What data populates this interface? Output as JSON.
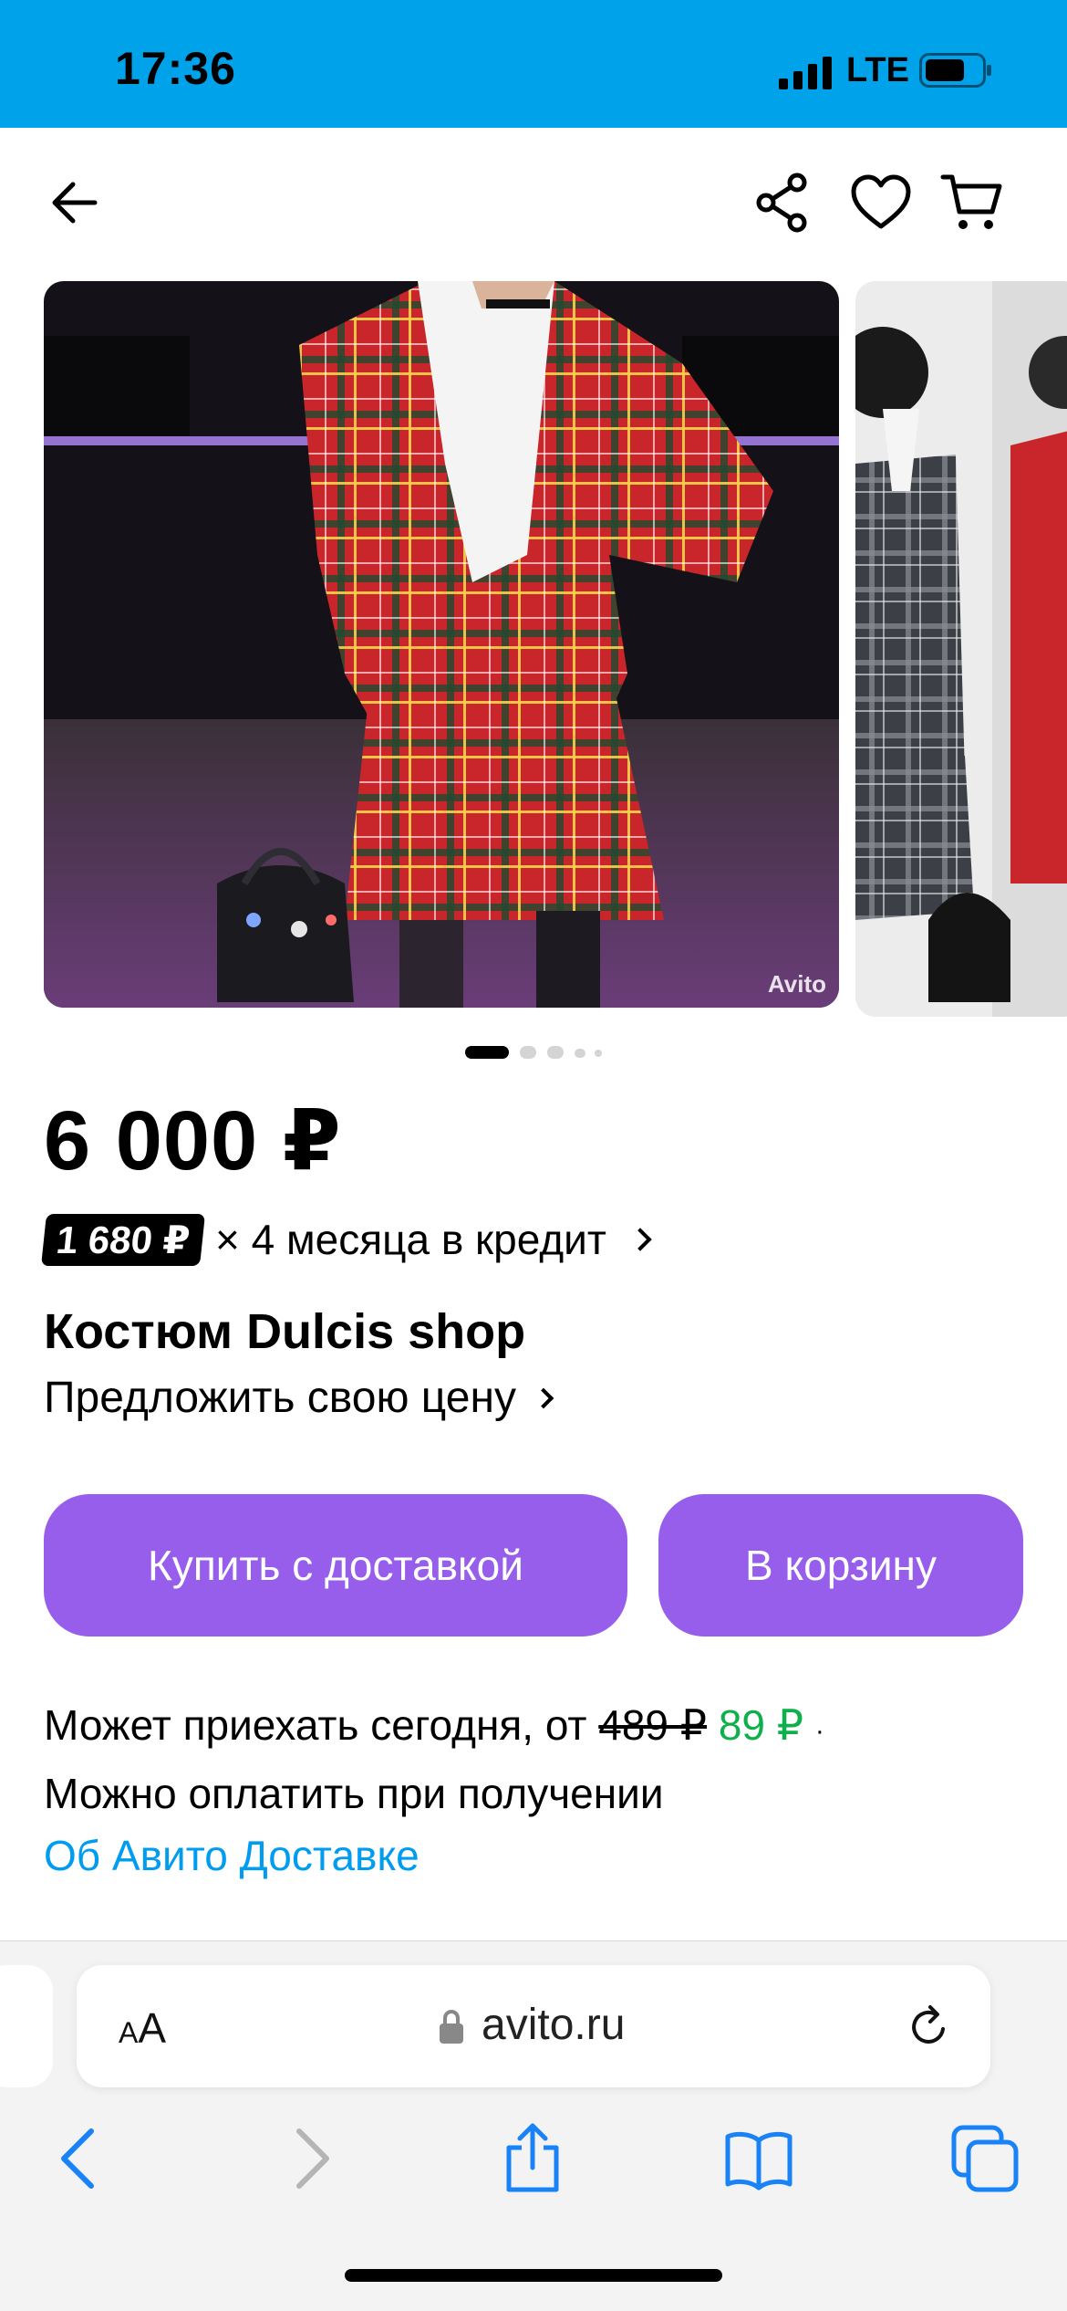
{
  "status_bar": {
    "time": "17:36",
    "network": "LTE"
  },
  "top_nav": {
    "back_icon": "arrow-left-icon",
    "share_icon": "share-icon",
    "favorite_icon": "heart-icon",
    "cart_icon": "cart-icon"
  },
  "gallery": {
    "watermark": "Avito",
    "page_count": 5,
    "active_page": 1
  },
  "product": {
    "price": "6 000 ₽",
    "credit_badge": "1 680 ₽",
    "credit_text": "× 4 месяца в кредит",
    "title": "Костюм Dulcis shop",
    "offer_price": "Предложить свою цену"
  },
  "buttons": {
    "buy_with_delivery": "Купить с доставкой",
    "add_to_cart": "В корзину"
  },
  "delivery": {
    "arrive_prefix": "Может приехать сегодня, от",
    "old_price": "489 ₽",
    "new_price": "89 ₽",
    "separator": "·",
    "pay_on_receipt": "Можно оплатить при получении",
    "about_link": "Об Авито Доставке"
  },
  "browser": {
    "text_size_label_small": "A",
    "text_size_label_large": "A",
    "url": "avito.ru"
  },
  "colors": {
    "status_bar": "#00a3ea",
    "button": "#965eeb",
    "new_price": "#0fb04b",
    "link": "#009cf0"
  }
}
